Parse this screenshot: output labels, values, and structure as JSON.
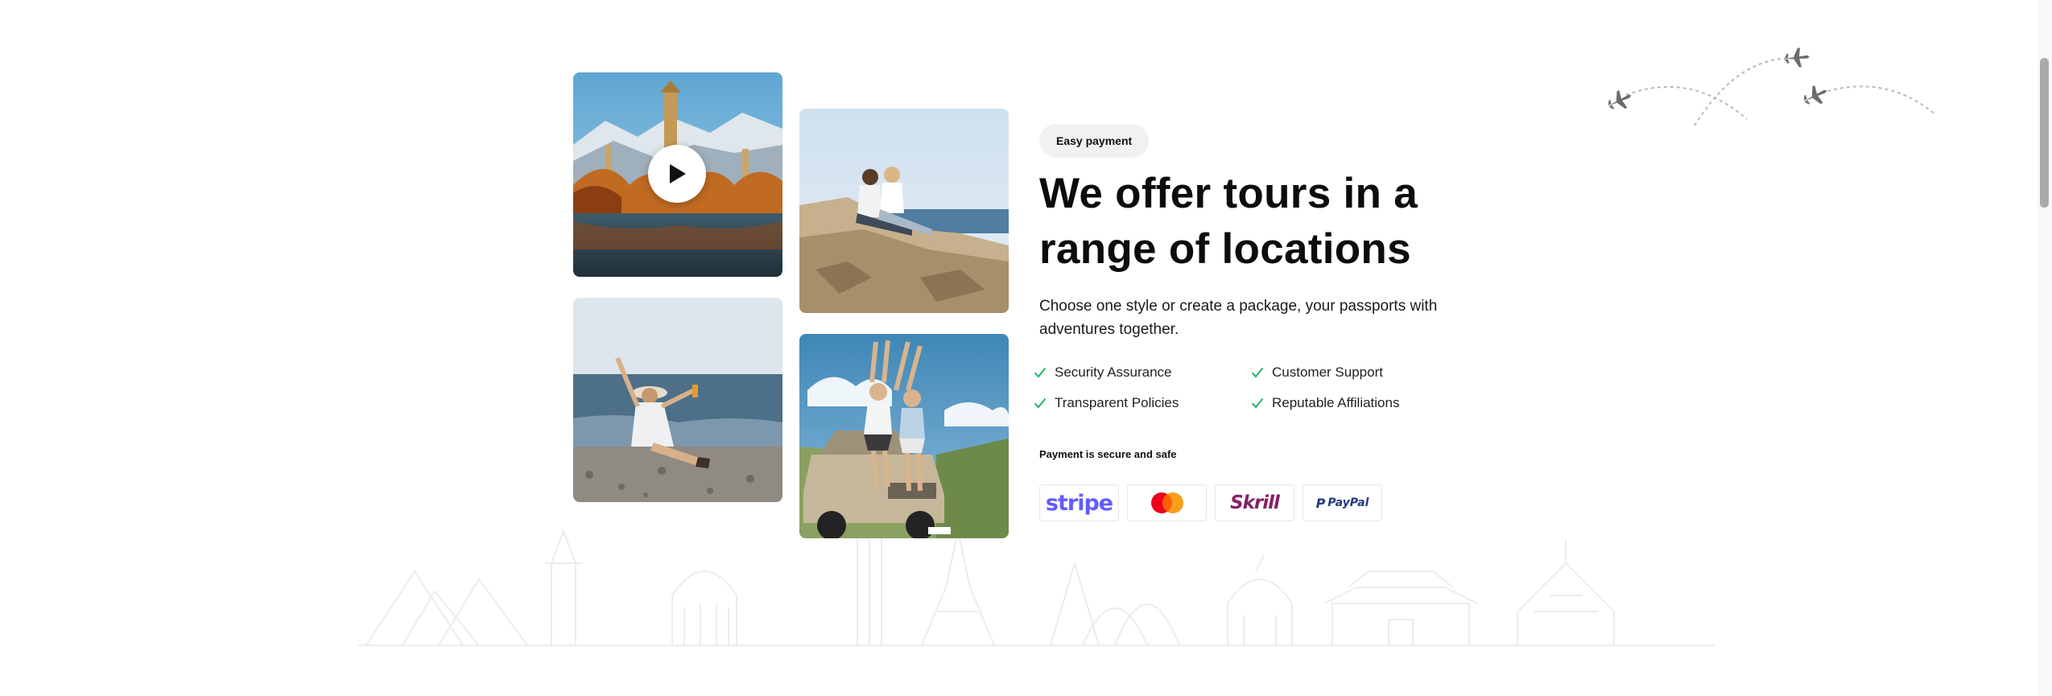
{
  "section": {
    "badge": "Easy payment",
    "title": "We offer tours in a range of locations",
    "description": "Choose one style or create a package, your passports with adventures together."
  },
  "features": [
    {
      "label": "Security Assurance",
      "icon": "check-icon"
    },
    {
      "label": "Customer Support",
      "icon": "check-icon"
    },
    {
      "label": "Transparent Policies",
      "icon": "check-icon"
    },
    {
      "label": "Reputable Affiliations",
      "icon": "check-icon"
    }
  ],
  "payment": {
    "note": "Payment is secure and safe",
    "methods": [
      {
        "name": "stripe",
        "logo_text": "stripe"
      },
      {
        "name": "mastercard",
        "logo_text": ""
      },
      {
        "name": "skrill",
        "logo_text": "Skrill"
      },
      {
        "name": "paypal",
        "logo_text": "PayPal"
      }
    ]
  },
  "gallery": [
    {
      "subject": "pagoda-lake-autumn",
      "icon": "play-icon"
    },
    {
      "subject": "two-women-on-cliff"
    },
    {
      "subject": "woman-on-beach"
    },
    {
      "subject": "two-women-on-jeep"
    }
  ],
  "colors": {
    "check": "#1fb46a",
    "stripe": "#635bff",
    "skrill": "#862165",
    "paypal_dark": "#253b80",
    "paypal_light": "#179bd7",
    "mastercard_red": "#eb001b",
    "mastercard_orange": "#f79e1b"
  }
}
